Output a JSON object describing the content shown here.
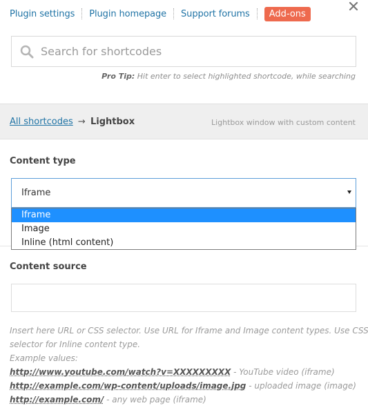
{
  "header": {
    "links": [
      "Plugin settings",
      "Plugin homepage",
      "Support forums"
    ],
    "addons_label": "Add-ons",
    "close_icon": "close-icon"
  },
  "search": {
    "placeholder": "Search for shortcodes",
    "icon": "search-icon"
  },
  "protip": {
    "label": "Pro Tip:",
    "text": " Hit enter to select highlighted shortcode, while searching"
  },
  "breadcrumb": {
    "all": "All shortcodes",
    "arrow": "→",
    "current": "Lightbox",
    "description": "Lightbox window with custom content"
  },
  "content_type": {
    "label": "Content type",
    "value": "Iframe",
    "options": [
      "Iframe",
      "Image",
      "Inline (html content)"
    ],
    "highlighted": "Iframe"
  },
  "content_source": {
    "label": "Content source",
    "value": "",
    "help_line1": "Insert here URL or CSS selector. Use URL for Iframe and Image content types. Use CSS",
    "help_line2": "selector for Inline content type.",
    "examples_label": "Example values:",
    "examples": [
      {
        "url": "http://www.youtube.com/watch?v=XXXXXXXXX",
        "desc": " - YouTube video (iframe)"
      },
      {
        "url": "http://example.com/wp-content/uploads/image.jpg",
        "desc": " - uploaded image (image)"
      },
      {
        "url": "http://example.com/",
        "desc": " - any web page (iframe)"
      }
    ]
  }
}
